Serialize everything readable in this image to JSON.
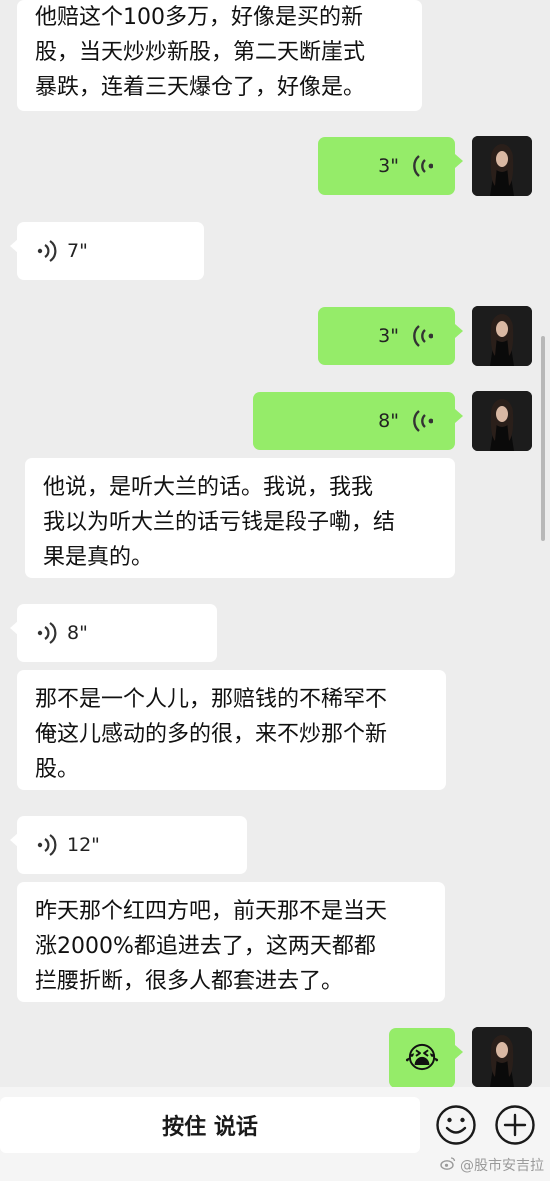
{
  "messages": [
    {
      "side": "in",
      "type": "text",
      "lines": [
        "他赔这个100多万，好像是买的新",
        "股，当天炒炒新股，第二天断崖式",
        "暴跌，连着三天爆仓了，好像是。"
      ]
    },
    {
      "side": "out",
      "type": "voice",
      "duration": "3\""
    },
    {
      "side": "in",
      "type": "voice",
      "duration": "7\""
    },
    {
      "side": "out",
      "type": "voice",
      "duration": "3\""
    },
    {
      "side": "out",
      "type": "voice",
      "duration": "8\""
    },
    {
      "side": "in",
      "type": "text",
      "lines": [
        "他说，是听大兰的话。我说，我我",
        "我以为听大兰的话亏钱是段子嘞，结",
        "果是真的。"
      ]
    },
    {
      "side": "in",
      "type": "voice",
      "duration": "8\""
    },
    {
      "side": "in",
      "type": "text",
      "lines": [
        "那不是一个人儿，那赔钱的不稀罕不",
        "俺这儿感动的多的很，来不炒那个新",
        "股。"
      ]
    },
    {
      "side": "in",
      "type": "voice",
      "duration": "12\""
    },
    {
      "side": "in",
      "type": "text",
      "lines": [
        "昨天那个红四方吧，前天那不是当天",
        "涨2000%都追进去了，这两天都都",
        "拦腰折断，很多人都套进去了。"
      ]
    },
    {
      "side": "out",
      "type": "emoji",
      "emoji": "😭"
    }
  ],
  "input_bar": {
    "hold_to_talk": "按住 说话",
    "emoji_icon": "emoji-icon",
    "plus_icon": "plus-icon"
  },
  "watermark": "@股市安吉拉",
  "colors": {
    "outgoing": "#95ec69",
    "incoming": "#ffffff",
    "background": "#ededed"
  }
}
